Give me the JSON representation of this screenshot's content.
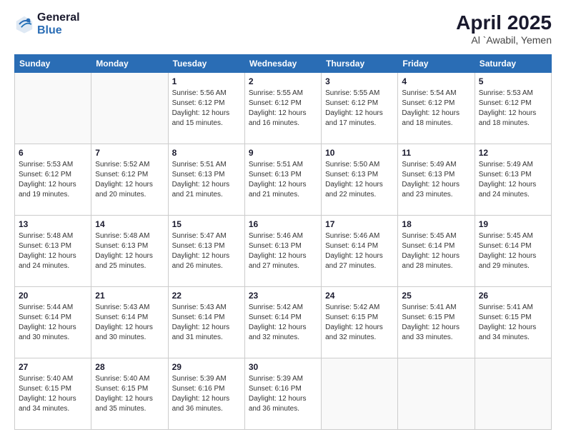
{
  "logo": {
    "general": "General",
    "blue": "Blue"
  },
  "header": {
    "title": "April 2025",
    "subtitle": "Al `Awabil, Yemen"
  },
  "days_of_week": [
    "Sunday",
    "Monday",
    "Tuesday",
    "Wednesday",
    "Thursday",
    "Friday",
    "Saturday"
  ],
  "weeks": [
    [
      {
        "day": "",
        "info": ""
      },
      {
        "day": "",
        "info": ""
      },
      {
        "day": "1",
        "info": "Sunrise: 5:56 AM\nSunset: 6:12 PM\nDaylight: 12 hours and 15 minutes."
      },
      {
        "day": "2",
        "info": "Sunrise: 5:55 AM\nSunset: 6:12 PM\nDaylight: 12 hours and 16 minutes."
      },
      {
        "day": "3",
        "info": "Sunrise: 5:55 AM\nSunset: 6:12 PM\nDaylight: 12 hours and 17 minutes."
      },
      {
        "day": "4",
        "info": "Sunrise: 5:54 AM\nSunset: 6:12 PM\nDaylight: 12 hours and 18 minutes."
      },
      {
        "day": "5",
        "info": "Sunrise: 5:53 AM\nSunset: 6:12 PM\nDaylight: 12 hours and 18 minutes."
      }
    ],
    [
      {
        "day": "6",
        "info": "Sunrise: 5:53 AM\nSunset: 6:12 PM\nDaylight: 12 hours and 19 minutes."
      },
      {
        "day": "7",
        "info": "Sunrise: 5:52 AM\nSunset: 6:12 PM\nDaylight: 12 hours and 20 minutes."
      },
      {
        "day": "8",
        "info": "Sunrise: 5:51 AM\nSunset: 6:13 PM\nDaylight: 12 hours and 21 minutes."
      },
      {
        "day": "9",
        "info": "Sunrise: 5:51 AM\nSunset: 6:13 PM\nDaylight: 12 hours and 21 minutes."
      },
      {
        "day": "10",
        "info": "Sunrise: 5:50 AM\nSunset: 6:13 PM\nDaylight: 12 hours and 22 minutes."
      },
      {
        "day": "11",
        "info": "Sunrise: 5:49 AM\nSunset: 6:13 PM\nDaylight: 12 hours and 23 minutes."
      },
      {
        "day": "12",
        "info": "Sunrise: 5:49 AM\nSunset: 6:13 PM\nDaylight: 12 hours and 24 minutes."
      }
    ],
    [
      {
        "day": "13",
        "info": "Sunrise: 5:48 AM\nSunset: 6:13 PM\nDaylight: 12 hours and 24 minutes."
      },
      {
        "day": "14",
        "info": "Sunrise: 5:48 AM\nSunset: 6:13 PM\nDaylight: 12 hours and 25 minutes."
      },
      {
        "day": "15",
        "info": "Sunrise: 5:47 AM\nSunset: 6:13 PM\nDaylight: 12 hours and 26 minutes."
      },
      {
        "day": "16",
        "info": "Sunrise: 5:46 AM\nSunset: 6:13 PM\nDaylight: 12 hours and 27 minutes."
      },
      {
        "day": "17",
        "info": "Sunrise: 5:46 AM\nSunset: 6:14 PM\nDaylight: 12 hours and 27 minutes."
      },
      {
        "day": "18",
        "info": "Sunrise: 5:45 AM\nSunset: 6:14 PM\nDaylight: 12 hours and 28 minutes."
      },
      {
        "day": "19",
        "info": "Sunrise: 5:45 AM\nSunset: 6:14 PM\nDaylight: 12 hours and 29 minutes."
      }
    ],
    [
      {
        "day": "20",
        "info": "Sunrise: 5:44 AM\nSunset: 6:14 PM\nDaylight: 12 hours and 30 minutes."
      },
      {
        "day": "21",
        "info": "Sunrise: 5:43 AM\nSunset: 6:14 PM\nDaylight: 12 hours and 30 minutes."
      },
      {
        "day": "22",
        "info": "Sunrise: 5:43 AM\nSunset: 6:14 PM\nDaylight: 12 hours and 31 minutes."
      },
      {
        "day": "23",
        "info": "Sunrise: 5:42 AM\nSunset: 6:14 PM\nDaylight: 12 hours and 32 minutes."
      },
      {
        "day": "24",
        "info": "Sunrise: 5:42 AM\nSunset: 6:15 PM\nDaylight: 12 hours and 32 minutes."
      },
      {
        "day": "25",
        "info": "Sunrise: 5:41 AM\nSunset: 6:15 PM\nDaylight: 12 hours and 33 minutes."
      },
      {
        "day": "26",
        "info": "Sunrise: 5:41 AM\nSunset: 6:15 PM\nDaylight: 12 hours and 34 minutes."
      }
    ],
    [
      {
        "day": "27",
        "info": "Sunrise: 5:40 AM\nSunset: 6:15 PM\nDaylight: 12 hours and 34 minutes."
      },
      {
        "day": "28",
        "info": "Sunrise: 5:40 AM\nSunset: 6:15 PM\nDaylight: 12 hours and 35 minutes."
      },
      {
        "day": "29",
        "info": "Sunrise: 5:39 AM\nSunset: 6:16 PM\nDaylight: 12 hours and 36 minutes."
      },
      {
        "day": "30",
        "info": "Sunrise: 5:39 AM\nSunset: 6:16 PM\nDaylight: 12 hours and 36 minutes."
      },
      {
        "day": "",
        "info": ""
      },
      {
        "day": "",
        "info": ""
      },
      {
        "day": "",
        "info": ""
      }
    ]
  ]
}
